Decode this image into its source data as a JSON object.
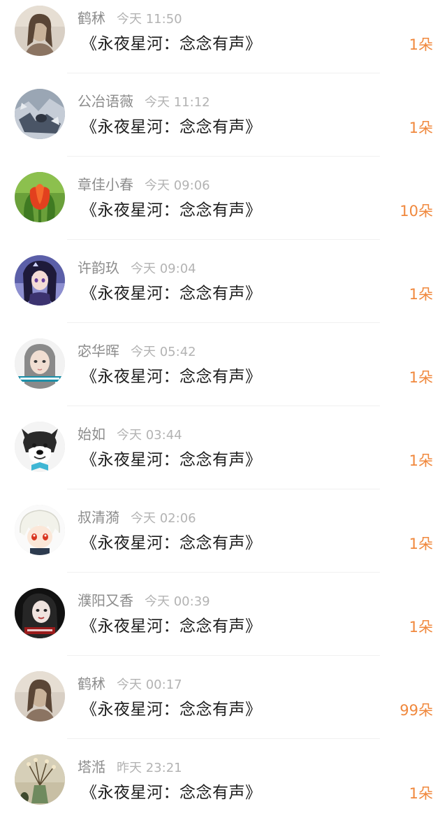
{
  "gifts": [
    {
      "name": "鹤秫",
      "time": "今天 11:50",
      "title": "《永夜星河：念念有声》",
      "count": "1朵",
      "avatar": "girl-sepia-avatar"
    },
    {
      "name": "公冶语薇",
      "time": "今天 11:12",
      "title": "《永夜星河：念念有声》",
      "count": "1朵",
      "avatar": "silver-photo-avatar"
    },
    {
      "name": "章佳小春",
      "time": "今天 09:06",
      "title": "《永夜星河：念念有声》",
      "count": "10朵",
      "avatar": "tulip-avatar"
    },
    {
      "name": "许韵玖",
      "time": "今天 09:04",
      "title": "《永夜星河：念念有声》",
      "count": "1朵",
      "avatar": "anime-girl-avatar"
    },
    {
      "name": "宓华晖",
      "time": "今天 05:42",
      "title": "《永夜星河：念念有声》",
      "count": "1朵",
      "avatar": "girl-portrait-avatar"
    },
    {
      "name": "始如",
      "time": "今天 03:44",
      "title": "《永夜星河：念念有声》",
      "count": "1朵",
      "avatar": "husky-dog-avatar"
    },
    {
      "name": "叔清漪",
      "time": "今天 02:06",
      "title": "《永夜星河：念念有声》",
      "count": "1朵",
      "avatar": "anime-boy-avatar"
    },
    {
      "name": "濮阳又香",
      "time": "今天 00:39",
      "title": "《永夜星河：念念有声》",
      "count": "1朵",
      "avatar": "dark-portrait-avatar"
    },
    {
      "name": "鹤秫",
      "time": "今天 00:17",
      "title": "《永夜星河：念念有声》",
      "count": "99朵",
      "avatar": "girl-sepia-avatar"
    },
    {
      "name": "塔湉",
      "time": "昨天 23:21",
      "title": "《永夜星河：念念有声》",
      "count": "1朵",
      "avatar": "flower-vase-avatar"
    }
  ],
  "colors": {
    "accent": "#f0883d",
    "name": "#8c8c8c",
    "time": "#b3b3b3",
    "title": "#1e1e1e"
  }
}
